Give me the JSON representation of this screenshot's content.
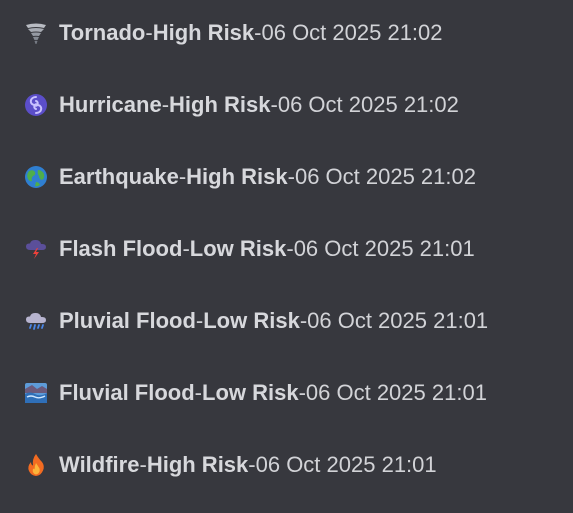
{
  "alerts": [
    {
      "icon": "tornado-icon",
      "name": "Tornado",
      "risk": "High Risk",
      "timestamp": "06 Oct 2025 21:02"
    },
    {
      "icon": "hurricane-icon",
      "name": "Hurricane",
      "risk": "High Risk",
      "timestamp": "06 Oct 2025 21:02"
    },
    {
      "icon": "globe-icon",
      "name": "Earthquake",
      "risk": "High Risk",
      "timestamp": "06 Oct 2025 21:02"
    },
    {
      "icon": "storm-lightning-icon",
      "name": "Flash Flood",
      "risk": "Low Risk",
      "timestamp": "06 Oct 2025 21:01"
    },
    {
      "icon": "rain-cloud-icon",
      "name": "Pluvial Flood",
      "risk": "Low Risk",
      "timestamp": "06 Oct 2025 21:01"
    },
    {
      "icon": "river-wave-icon",
      "name": "Fluvial Flood",
      "risk": "Low Risk",
      "timestamp": "06 Oct 2025 21:01"
    },
    {
      "icon": "fire-icon",
      "name": "Wildfire",
      "risk": "High Risk",
      "timestamp": "06 Oct 2025 21:01"
    }
  ],
  "separator": " - "
}
